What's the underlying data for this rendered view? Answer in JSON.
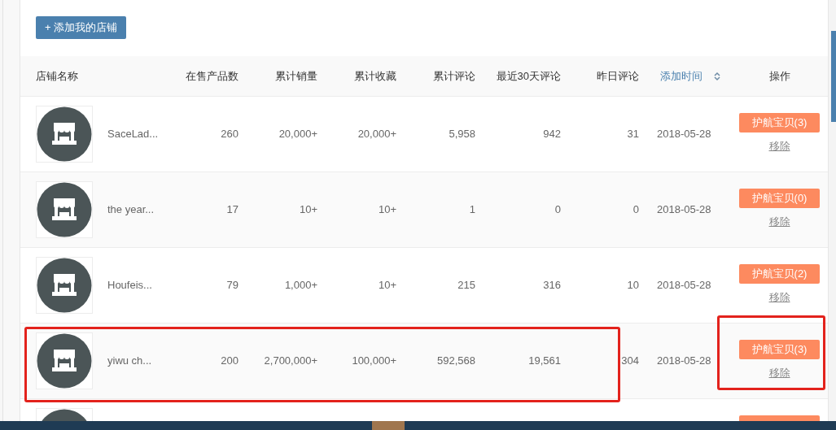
{
  "add_button": {
    "label": "+ 添加我的店铺"
  },
  "table": {
    "columns": [
      {
        "label": "店铺名称",
        "sortable": false
      },
      {
        "label": "在售产品数",
        "sortable": false
      },
      {
        "label": "累计销量",
        "sortable": false
      },
      {
        "label": "累计收藏",
        "sortable": false
      },
      {
        "label": "累计评论",
        "sortable": false
      },
      {
        "label": "最近30天评论",
        "sortable": false
      },
      {
        "label": "昨日评论",
        "sortable": false
      },
      {
        "label": "添加时间",
        "sortable": true
      },
      {
        "label": "操作",
        "sortable": false
      }
    ],
    "rows": [
      {
        "kind": "full",
        "shop_name": "SaceLad...",
        "products_on_sale": "260",
        "total_sales": "20,000+",
        "total_favorites": "20,000+",
        "total_reviews": "5,958",
        "reviews_30_days": "942",
        "reviews_yesterday": "31",
        "added_on": "2018-05-28",
        "escort_button": "护航宝贝(3)",
        "remove_link": "移除",
        "stats_framed": false,
        "actions_framed": false
      },
      {
        "kind": "full",
        "shop_name": "the year...",
        "products_on_sale": "17",
        "total_sales": "10+",
        "total_favorites": "10+",
        "total_reviews": "1",
        "reviews_30_days": "0",
        "reviews_yesterday": "0",
        "added_on": "2018-05-28",
        "escort_button": "护航宝贝(0)",
        "remove_link": "移除",
        "stats_framed": false,
        "actions_framed": false
      },
      {
        "kind": "full",
        "shop_name": "Houfeis...",
        "products_on_sale": "79",
        "total_sales": "1,000+",
        "total_favorites": "10+",
        "total_reviews": "215",
        "reviews_30_days": "316",
        "reviews_yesterday": "10",
        "added_on": "2018-05-28",
        "escort_button": "护航宝贝(2)",
        "remove_link": "移除",
        "stats_framed": false,
        "actions_framed": false
      },
      {
        "kind": "full",
        "shop_name": "yiwu ch...",
        "products_on_sale": "200",
        "total_sales": "2,700,000+",
        "total_favorites": "100,000+",
        "total_reviews": "592,568",
        "reviews_30_days": "19,561",
        "reviews_yesterday": "304",
        "added_on": "2018-05-28",
        "escort_button": "护航宝贝(3)",
        "remove_link": "移除",
        "stats_framed": true,
        "actions_framed": true
      },
      {
        "kind": "cut",
        "stats_framed": false,
        "actions_framed": false
      }
    ]
  }
}
